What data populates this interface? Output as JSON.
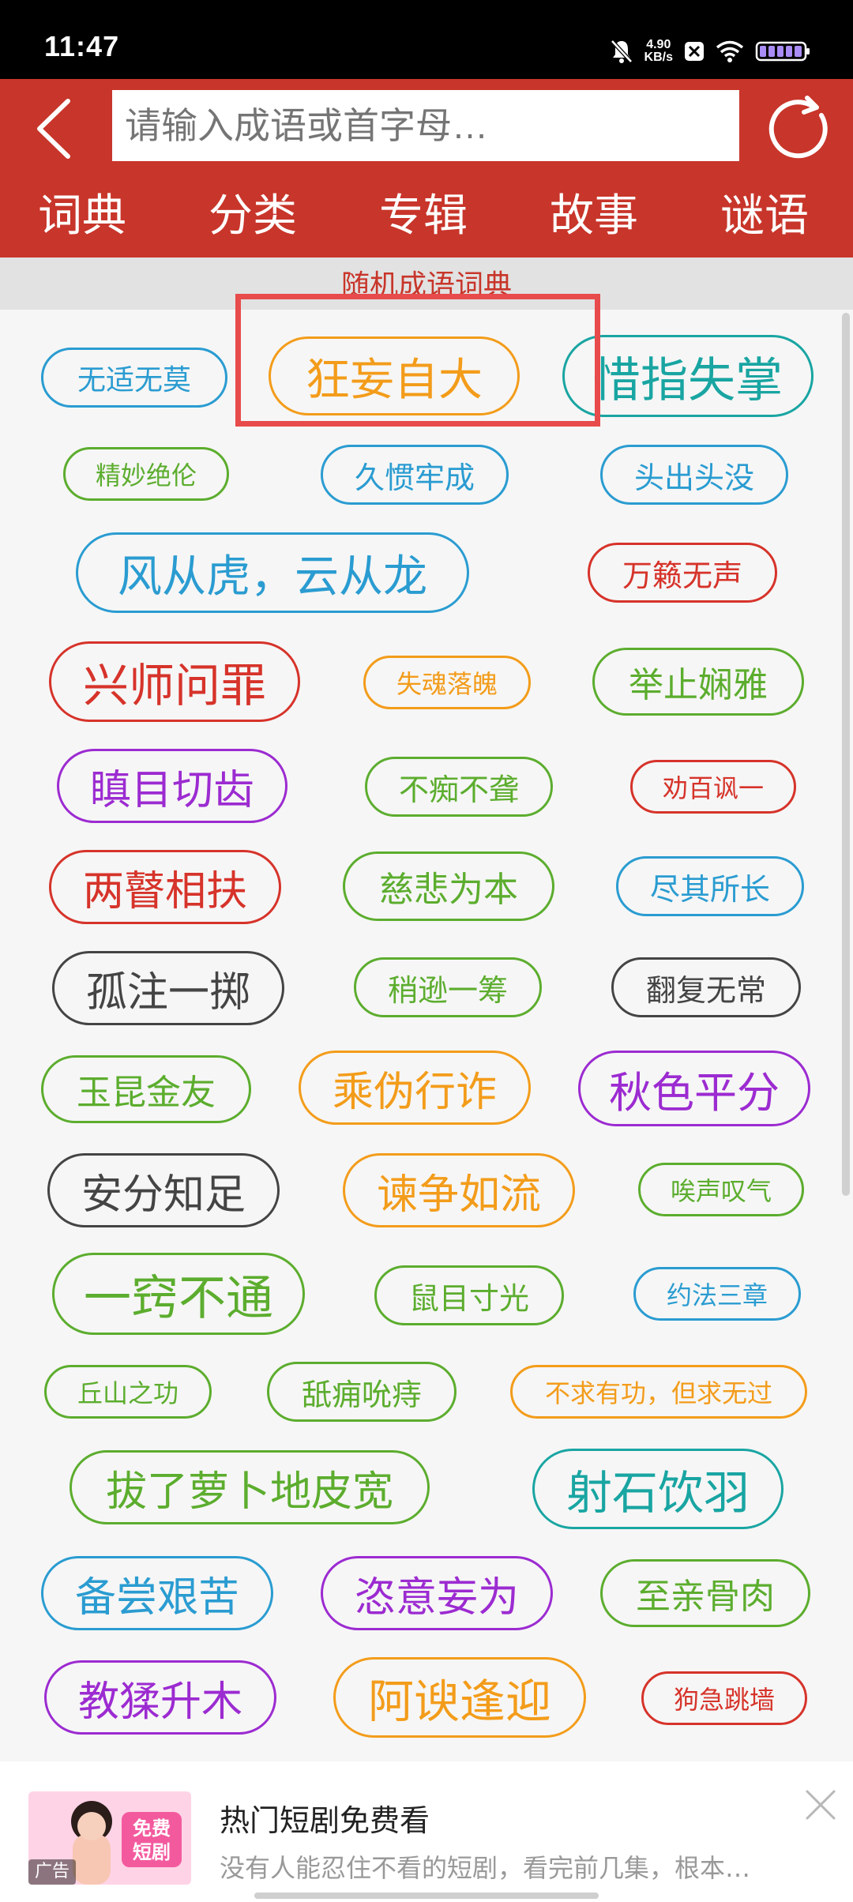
{
  "status_bar": {
    "time": "11:47",
    "net_speed_value": "4.90",
    "net_speed_unit": "KB/s",
    "icons": [
      "mute-bell-icon",
      "data-speed",
      "x-app-icon",
      "wifi-icon",
      "battery-icon"
    ]
  },
  "header": {
    "search_placeholder": "请输入成语或首字母…",
    "tabs": [
      "词典",
      "分类",
      "专辑",
      "故事",
      "谜语"
    ],
    "accent_color": "#c8352a"
  },
  "section_title": "随机成语词典",
  "idioms": [
    {
      "text": "无适无莫",
      "color": "#2a9cd1"
    },
    {
      "text": "狂妄自大",
      "color": "#f39c1a"
    },
    {
      "text": "惜指失掌",
      "color": "#19a5a2"
    },
    {
      "text": "精妙绝伦",
      "color": "#5cad2e"
    },
    {
      "text": "久惯牢成",
      "color": "#2a9cd1"
    },
    {
      "text": "头出头没",
      "color": "#2a9cd1"
    },
    {
      "text": "风从虎，云从龙",
      "color": "#2a9cd1"
    },
    {
      "text": "万籁无声",
      "color": "#d6332a"
    },
    {
      "text": "兴师问罪",
      "color": "#d6332a"
    },
    {
      "text": "失魂落魄",
      "color": "#f39c1a"
    },
    {
      "text": "举止娴雅",
      "color": "#5cad2e"
    },
    {
      "text": "瞋目切齿",
      "color": "#9c2bd1"
    },
    {
      "text": "不痴不聋",
      "color": "#5cad2e"
    },
    {
      "text": "劝百讽一",
      "color": "#d6332a"
    },
    {
      "text": "两瞽相扶",
      "color": "#d6332a"
    },
    {
      "text": "慈悲为本",
      "color": "#5cad2e"
    },
    {
      "text": "尽其所长",
      "color": "#2a9cd1"
    },
    {
      "text": "孤注一掷",
      "color": "#444444"
    },
    {
      "text": "稍逊一筹",
      "color": "#5cad2e"
    },
    {
      "text": "翻复无常",
      "color": "#444444"
    },
    {
      "text": "玉昆金友",
      "color": "#5cad2e"
    },
    {
      "text": "乘伪行诈",
      "color": "#f39c1a"
    },
    {
      "text": "秋色平分",
      "color": "#9c2bd1"
    },
    {
      "text": "安分知足",
      "color": "#444444"
    },
    {
      "text": "谏争如流",
      "color": "#f39c1a"
    },
    {
      "text": "唉声叹气",
      "color": "#5cad2e"
    },
    {
      "text": "一窍不通",
      "color": "#5cad2e"
    },
    {
      "text": "鼠目寸光",
      "color": "#5cad2e"
    },
    {
      "text": "约法三章",
      "color": "#2a9cd1"
    },
    {
      "text": "丘山之功",
      "color": "#5cad2e"
    },
    {
      "text": "舐痈吮痔",
      "color": "#5cad2e"
    },
    {
      "text": "不求有功，但求无过",
      "color": "#f39c1a"
    },
    {
      "text": "拔了萝卜地皮宽",
      "color": "#5cad2e"
    },
    {
      "text": "射石饮羽",
      "color": "#19a5a2"
    },
    {
      "text": "备尝艰苦",
      "color": "#2a9cd1"
    },
    {
      "text": "恣意妄为",
      "color": "#9c2bd1"
    },
    {
      "text": "至亲骨肉",
      "color": "#5cad2e"
    },
    {
      "text": "教猱升木",
      "color": "#9c2bd1"
    },
    {
      "text": "阿谀逢迎",
      "color": "#f39c1a"
    },
    {
      "text": "狗急跳墙",
      "color": "#d6332a"
    }
  ],
  "highlighted_idiom": "狂妄自大",
  "ad": {
    "title": "热门短剧免费看",
    "description": "没有人能忍住不看的短剧，看完前几集，根本…",
    "tag": "广告",
    "thumb_text": "免费短剧"
  }
}
